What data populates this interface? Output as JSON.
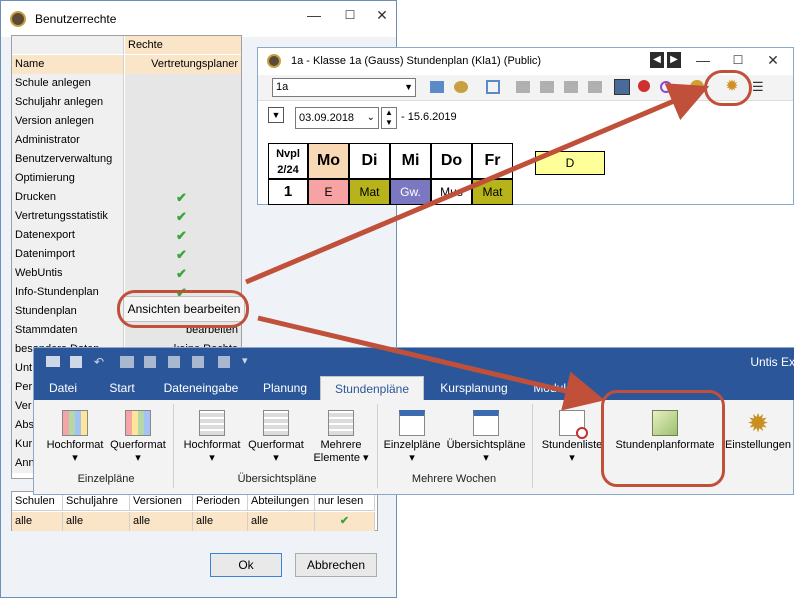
{
  "window1": {
    "title": "Benutzerrechte",
    "min": "—",
    "max": "☐",
    "close": "✕",
    "header_label": "Rechte",
    "rows": [
      {
        "name": "Name",
        "value": "Vertretungsplaner",
        "check": false,
        "highlight": true
      },
      {
        "name": "Schule anlegen",
        "value": "",
        "check": false
      },
      {
        "name": "Schuljahr anlegen",
        "value": "",
        "check": false
      },
      {
        "name": "Version anlegen",
        "value": "",
        "check": false
      },
      {
        "name": "Administrator",
        "value": "",
        "check": false
      },
      {
        "name": "Benutzerverwaltung",
        "value": "",
        "check": false
      },
      {
        "name": "Optimierung",
        "value": "",
        "check": false
      },
      {
        "name": "Drucken",
        "value": "",
        "check": true
      },
      {
        "name": "Vertretungsstatistik",
        "value": "",
        "check": true
      },
      {
        "name": "Datenexport",
        "value": "",
        "check": true
      },
      {
        "name": "Datenimport",
        "value": "",
        "check": true
      },
      {
        "name": "WebUntis",
        "value": "",
        "check": true
      },
      {
        "name": "Info-Stundenplan",
        "value": "",
        "check": true
      },
      {
        "name": "Stundenplan",
        "value": "Ansichten bearbeiten",
        "check": false
      },
      {
        "name": "Stammdaten",
        "value": "bearbeiten",
        "check": false
      },
      {
        "name": "besondere Daten",
        "value": "keine Rechte",
        "check": false
      },
      {
        "name": "Unt",
        "value": "",
        "check": false
      },
      {
        "name": "Per",
        "value": "",
        "check": false
      },
      {
        "name": "Ver",
        "value": "",
        "check": false
      },
      {
        "name": "Abs",
        "value": "",
        "check": false
      },
      {
        "name": "Kur",
        "value": "",
        "check": false
      },
      {
        "name": "Ann",
        "value": "",
        "check": false
      }
    ],
    "popup_value": "Ansichten bearbeiten",
    "grid2_headers": [
      "Schulen",
      "Schuljahre",
      "Versionen",
      "Perioden",
      "Abteilungen",
      "nur lesen"
    ],
    "grid2_values": [
      "alle",
      "alle",
      "alle",
      "alle",
      "alle",
      "✔"
    ],
    "ok_label": "Ok",
    "cancel_label": "Abbrechen"
  },
  "window2": {
    "title": "1a - Klasse 1a (Gauss)  Stundenplan  (Kla1) (Public)",
    "class_value": "1a",
    "date_value": "03.09.2018",
    "date_end": "- 15.6.2019",
    "period_header": "Nvpl\n2/24",
    "days": [
      "Mo",
      "Di",
      "Mi",
      "Do",
      "Fr"
    ],
    "row_number": "1",
    "cells": [
      "E",
      "Mat",
      "Gw.",
      "Mus",
      "Mat"
    ],
    "extra_cell": "D",
    "colors": {
      "mo": "#f9d9b5",
      "e": "#f7a3a3",
      "mat": "#b6b41a",
      "gw": "#7b78c1",
      "extra": "#ffff99"
    }
  },
  "ribbon": {
    "app_title": "Untis Ex",
    "tabs": [
      "Datei",
      "Start",
      "Dateneingabe",
      "Planung",
      "Stundenpläne",
      "Kursplanung",
      "Module"
    ],
    "active_tab": "Stundenpläne",
    "groups": [
      {
        "label": "Einzelpläne",
        "buttons": [
          "Hochformat",
          "Querformat"
        ]
      },
      {
        "label": "Übersichtspläne",
        "buttons": [
          "Hochformat",
          "Querformat",
          "Mehrere Elemente"
        ]
      },
      {
        "label": "Mehrere Wochen",
        "buttons": [
          "Einzelpläne",
          "Übersichtspläne"
        ]
      }
    ],
    "stundenliste": "Stundenliste",
    "stundenplanformate": "Stundenplanformate",
    "einstellungen": "Einstellungen",
    "accent": "#2b579a"
  }
}
